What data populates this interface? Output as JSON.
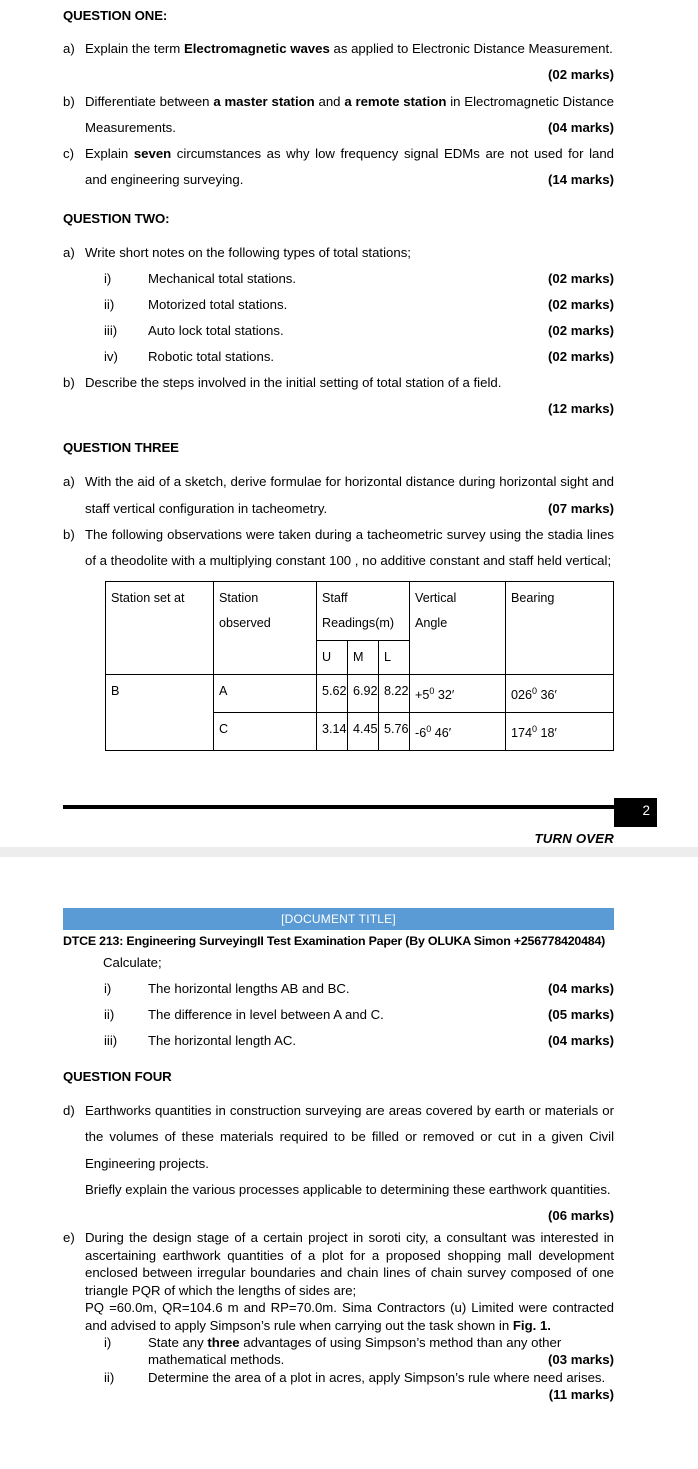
{
  "document": {
    "banner_title": "[DOCUMENT TITLE]",
    "subtitle": "DTCE 213: Engineering SurveyingII Test Examination Paper (By OLUKA Simon +256778420484)",
    "banner_color": "#5b9bd5",
    "page_separator_color": "#ededed"
  },
  "page_one": {
    "cut_off_line": "",
    "question_one": {
      "heading": "QUESTION ONE:",
      "items": [
        {
          "marker": "a)",
          "text_before": "Explain the term ",
          "bold": "Electromagnetic waves",
          "text_after": " as applied to Electronic Distance Measurement.",
          "marks": "(02 marks)"
        },
        {
          "marker": "b)",
          "text_before": "Differentiate between ",
          "bold": "a master station",
          "text_mid": " and ",
          "bold2": "a remote station",
          "text_after": " in Electromagnetic Distance Measurements.",
          "marks": "(04 marks)"
        },
        {
          "marker": "c)",
          "text_before": "Explain ",
          "bold": "seven",
          "text_after": " circumstances as why low frequency signal EDMs are not used for land and engineering surveying.",
          "marks": "(14 marks)"
        }
      ]
    },
    "question_two": {
      "heading": "QUESTION TWO:",
      "item_a": {
        "marker": "a)",
        "text": "Write short notes on the following types of total stations;"
      },
      "sub_items": [
        {
          "marker": "i)",
          "text": "Mechanical total stations.",
          "marks": "(02 marks)"
        },
        {
          "marker": "ii)",
          "text": "Motorized total stations.",
          "marks": "(02 marks)"
        },
        {
          "marker": "iii)",
          "text": "Auto lock total stations.",
          "marks": "(02 marks)"
        },
        {
          "marker": "iv)",
          "text": "Robotic total stations.",
          "marks": "(02 marks)"
        }
      ],
      "item_b": {
        "marker": "b)",
        "text": "Describe the steps involved in the initial setting of total station of a field.",
        "marks": "(12 marks)"
      }
    },
    "question_three": {
      "heading": "QUESTION THREE",
      "item_a": {
        "marker": "a)",
        "text": "With the aid of a sketch, derive formulae for horizontal distance during horizontal sight and staff vertical configuration in tacheometry.",
        "marks": "(07 marks)"
      },
      "item_b": {
        "marker": "b)",
        "text": "The following observations were taken during a tacheometric survey using the stadia lines of a theodolite with a multiplying constant 100 , no additive constant and staff held vertical;"
      },
      "table": {
        "headers": {
          "station_set_at": "Station set at",
          "station_observed_line1": "Station",
          "station_observed_line2": "observed",
          "staff_readings": "Staff Readings(m)",
          "u": "U",
          "m": "M",
          "l": "L",
          "vertical_line1": "Vertical",
          "vertical_line2": "Angle",
          "bearing": "Bearing"
        },
        "rows": [
          {
            "station_set_at": "B",
            "station_observed": "A",
            "u": "5.62",
            "m": "6.92",
            "l": "8.22",
            "vertical_angle_deg": "+5",
            "vertical_angle_min": " 32′",
            "bearing_deg": "026",
            "bearing_min": " 36′"
          },
          {
            "station_set_at": "",
            "station_observed": "C",
            "u": "3.14",
            "m": "4.45",
            "l": "5.76",
            "vertical_angle_deg": "-6",
            "vertical_angle_min": " 46′",
            "bearing_deg": "174",
            "bearing_min": " 18′"
          }
        ]
      }
    },
    "footer": {
      "page_number": "2",
      "turn_over": "TURN OVER"
    }
  },
  "page_two": {
    "calculate_label": "Calculate;",
    "calculate_items": [
      {
        "marker": "i)",
        "text": "The horizontal lengths AB and BC.",
        "marks": "(04 marks)"
      },
      {
        "marker": "ii)",
        "text": "The difference in level between A and C.",
        "marks": "(05 marks)"
      },
      {
        "marker": "iii)",
        "text": "The horizontal length AC.",
        "marks": "(04 marks)"
      }
    ],
    "question_four": {
      "heading": "QUESTION FOUR",
      "item_d": {
        "marker": "d)",
        "para1": "Earthworks quantities in construction surveying are areas covered by earth or materials or the volumes of these materials required to be filled or removed or cut in a given Civil Engineering projects.",
        "para2": "Briefly explain the various processes applicable to determining these earthwork quantities.",
        "marks": "(06 marks)"
      },
      "item_e": {
        "marker": "e)",
        "para1": "During the design stage of a certain project in soroti city, a consultant was interested in ascertaining earthwork quantities of a plot for a proposed shopping mall development enclosed between irregular boundaries and chain lines of chain survey composed of one triangle PQR of which the lengths of sides are;",
        "para2_before": "PQ =60.0m, QR=104.6 m and RP=70.0m. Sima Contractors (u) Limited were contracted and advised to apply Simpson’s rule when carrying out the task shown in ",
        "para2_bold": "Fig. 1.",
        "sub_items": [
          {
            "marker": "i)",
            "text_before": "State any ",
            "bold": "three",
            "text_after": " advantages of using Simpson’s method than any other mathematical methods.",
            "marks": "(03 marks)"
          },
          {
            "marker": "ii)",
            "text_before": "Determine the area of a plot in acres, apply Simpson’s rule where need arises.",
            "bold": "",
            "text_after": "",
            "marks": "(11 marks)"
          }
        ]
      }
    }
  }
}
